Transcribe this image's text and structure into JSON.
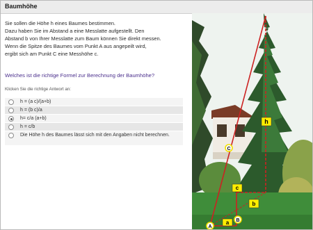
{
  "header": {
    "title": "Baumhöhe"
  },
  "intro": {
    "lines": [
      "Sie sollen die Höhe h eines Baumes bestimmen.",
      "Dazu haben Sie im Abstand a eine Messlatte aufgestellt. Den",
      "Abstand b von Ihrer Messlatte zum Baum können Sie direkt messen.",
      "Wenn die Spitze des Baumes vom Punkt A aus angepeilt wird,",
      "ergibt sich am Punkt C eine Messhöhe c."
    ]
  },
  "question": "Welches ist die richtige Formel zur Berechnung der Baumhöhe?",
  "instruction": "Klicken Sie die richtige Antwort an:",
  "options": [
    {
      "text": "h = (a   c)/(a+b)",
      "selected": false
    },
    {
      "text": "h = (b   c)/a",
      "selected": false
    },
    {
      "text": "h= c/a   (a+b)",
      "selected": true
    },
    {
      "text": "h = c/b",
      "selected": false
    },
    {
      "text": "Die Höhe h des Baumes lässt sich mit den Angaben nicht berechnen.",
      "selected": false
    }
  ],
  "diagram": {
    "labels": {
      "h": "h",
      "c": "c",
      "b": "b",
      "a": "a",
      "A": "A",
      "B": "B",
      "C": "C"
    },
    "colors": {
      "line": "#cc2222",
      "label_bg": "#ffee00",
      "point_border": "#f2e000"
    }
  }
}
